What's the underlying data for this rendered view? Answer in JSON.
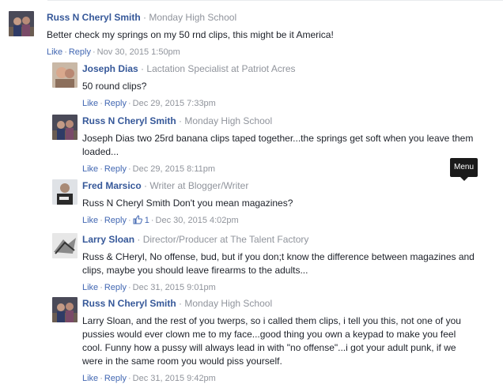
{
  "comments": [
    {
      "author": "Russ N Cheryl Smith",
      "tagline": "Monday High School",
      "text": "Better check my springs on my 50 rnd clips, this might be it America!",
      "like": "Like",
      "reply": "Reply",
      "date": "Nov 30, 2015 1:50pm"
    },
    {
      "author": "Joseph Dias",
      "tagline": "Lactation Specialist at Patriot Acres",
      "text": "50 round clips?",
      "like": "Like",
      "reply": "Reply",
      "date": "Dec 29, 2015 7:33pm"
    },
    {
      "author": "Russ N Cheryl Smith",
      "tagline": "Monday High School",
      "text": "Joseph Dias two 25rd banana clips taped together...the springs get soft when you leave them loaded...",
      "like": "Like",
      "reply": "Reply",
      "date": "Dec 29, 2015 8:11pm"
    },
    {
      "author": "Fred Marsico",
      "tagline": "Writer at Blogger/Writer",
      "text": "Russ N Cheryl Smith Don't you mean magazines?",
      "like": "Like",
      "reply": "Reply",
      "like_count": "1",
      "date": "Dec 30, 2015 4:02pm"
    },
    {
      "author": "Larry Sloan",
      "tagline": "Director/Producer at The Talent Factory",
      "text": "Russ & CHeryl, No offense, bud, but if you don;t know the difference between magazines and clips, maybe you should leave firearms to the adults...",
      "like": "Like",
      "reply": "Reply",
      "date": "Dec 31, 2015 9:01pm"
    },
    {
      "author": "Russ N Cheryl Smith",
      "tagline": "Monday High School",
      "text": "Larry Sloan, and the rest of you twerps, so i called them clips, i tell you this, not one of you pussies would ever clown me to my face...good thing you own a keypad to make you feel cool. Funny how a pussy will always lead in with \"no offense\"...i got your adult punk, if we were in the same room you would piss yourself.",
      "like": "Like",
      "reply": "Reply",
      "date": "Dec 31, 2015 9:42pm"
    }
  ],
  "tooltip": {
    "label": "Menu"
  },
  "colors": {
    "author": "#365899",
    "link": "#4267b2",
    "meta": "#90949c",
    "text": "#1d2129"
  }
}
